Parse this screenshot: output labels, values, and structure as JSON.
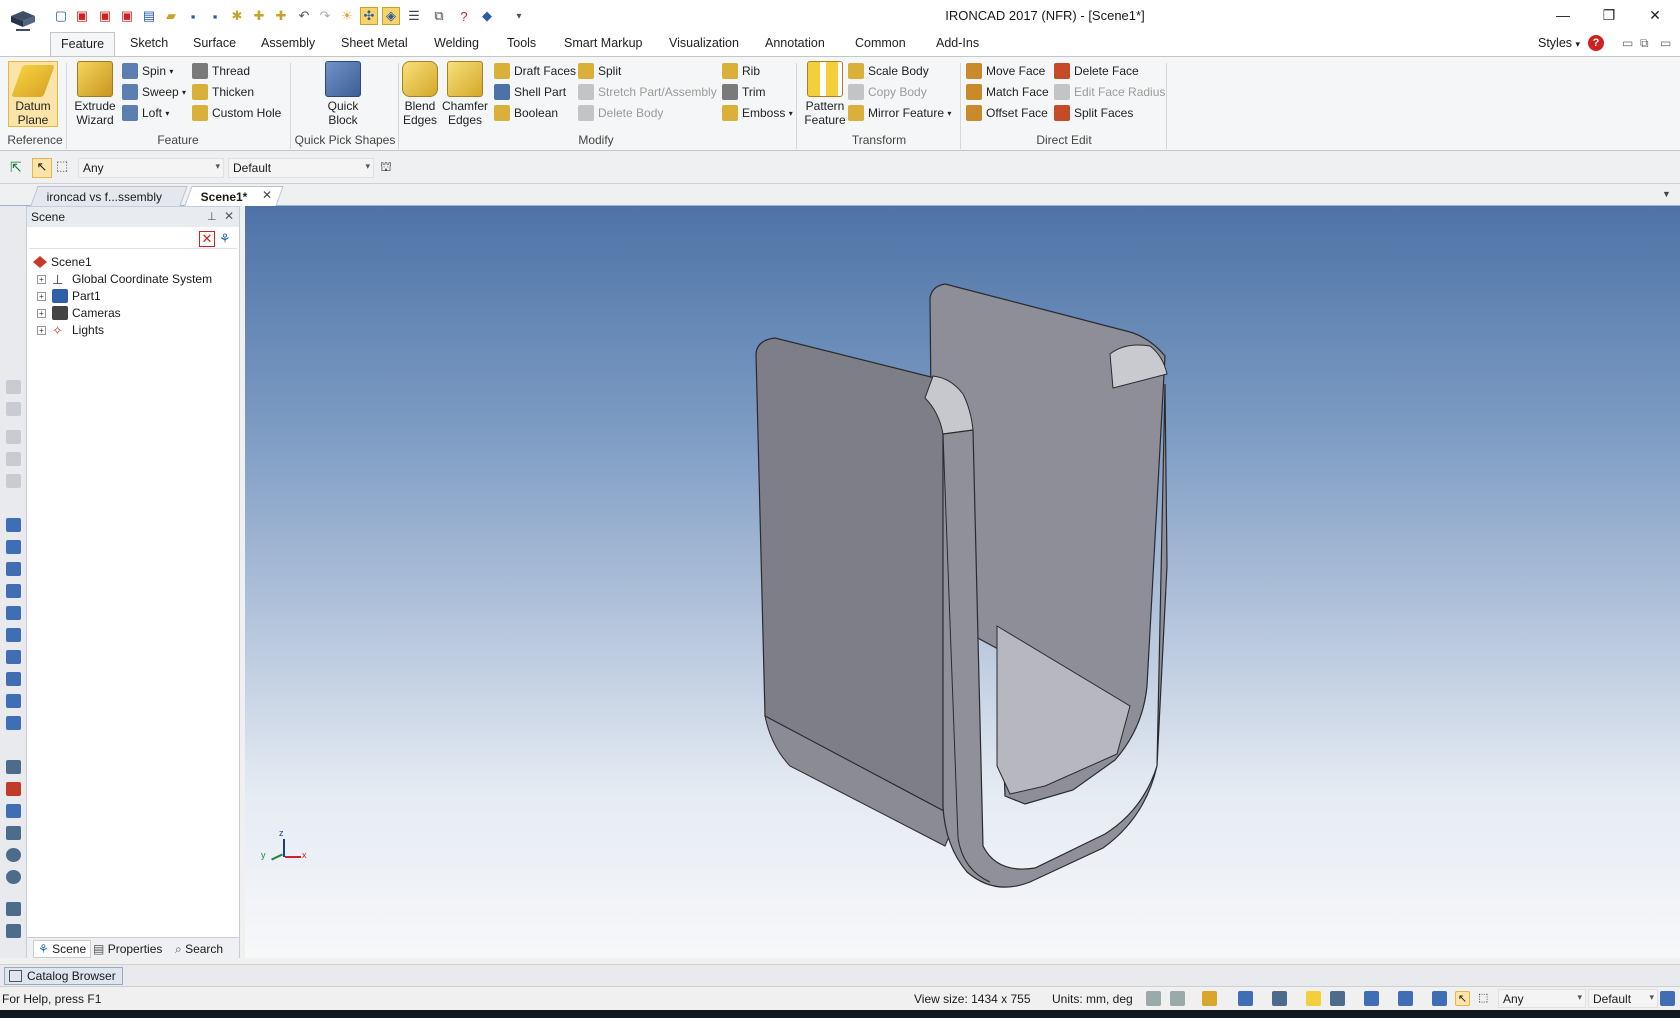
{
  "window": {
    "title": "IRONCAD 2017 (NFR) - [Scene1*]",
    "minimize_icon": "minimize-icon",
    "restore_icon": "restore-icon",
    "close_icon": "close-icon"
  },
  "ribbon_tabs": [
    "Feature",
    "Sketch",
    "Surface",
    "Assembly",
    "Sheet Metal",
    "Welding",
    "Tools",
    "Smart Markup",
    "Visualization",
    "Annotation",
    "Common",
    "Add-Ins"
  ],
  "styles_label": "Styles",
  "ribbon": {
    "reference": {
      "label": "Reference",
      "datum_plane": "Datum Plane"
    },
    "feature": {
      "label": "Feature",
      "extrude_wizard": "Extrude Wizard",
      "spin": "Spin",
      "sweep": "Sweep",
      "loft": "Loft",
      "thread": "Thread",
      "thicken": "Thicken",
      "custom_hole": "Custom Hole"
    },
    "quick_pick": {
      "label": "Quick Pick Shapes",
      "quick_block": "Quick Block"
    },
    "modify": {
      "label": "Modify",
      "blend_edges": "Blend Edges",
      "chamfer_edges": "Chamfer Edges",
      "draft_faces": "Draft Faces",
      "shell_part": "Shell Part",
      "boolean": "Boolean",
      "split": "Split",
      "stretch": "Stretch Part/Assembly",
      "delete_body": "Delete Body",
      "rib": "Rib",
      "trim": "Trim",
      "emboss": "Emboss"
    },
    "transform": {
      "label": "Transform",
      "pattern_feature": "Pattern Feature",
      "scale_body": "Scale Body",
      "copy_body": "Copy Body",
      "mirror_feature": "Mirror Feature"
    },
    "direct_edit": {
      "label": "Direct Edit",
      "move_face": "Move Face",
      "match_face": "Match Face",
      "offset_face": "Offset Face",
      "delete_face": "Delete Face",
      "edit_face_radius": "Edit Face Radius",
      "split_faces": "Split Faces"
    }
  },
  "selection": {
    "filter": "Any",
    "style": "Default"
  },
  "doc_tabs": [
    "ironcad vs f...ssembly",
    "Scene1*"
  ],
  "scene_panel": {
    "title": "Scene",
    "tree": [
      "Scene1",
      "Global Coordinate System",
      "Part1",
      "Cameras",
      "Lights"
    ],
    "tabs": [
      "Scene",
      "Properties",
      "Search"
    ]
  },
  "triad": {
    "x": "x",
    "y": "y",
    "z": "z"
  },
  "catalog_browser": "Catalog Browser",
  "status": {
    "help": "For Help, press F1",
    "view_size": "View size: 1434 x  755",
    "units": "Units: mm, deg",
    "filter": "Any",
    "style": "Default"
  }
}
